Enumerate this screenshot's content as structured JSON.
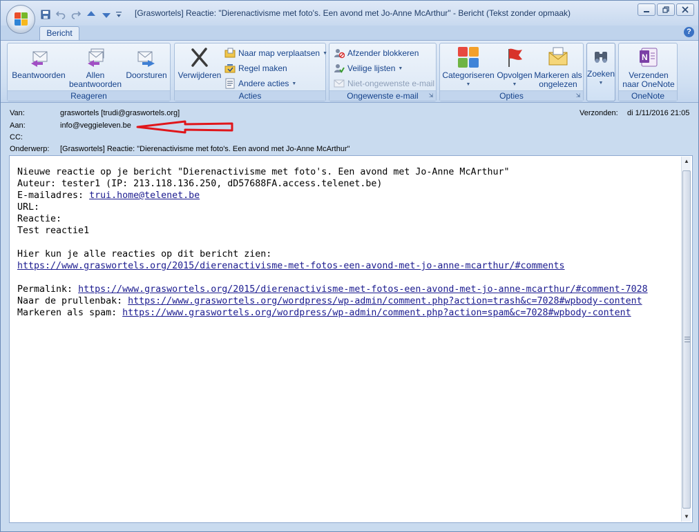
{
  "window": {
    "title": "[Graswortels] Reactie: \"Dierenactivisme met foto's. Een avond met Jo-Anne McArthur\" - Bericht (Tekst zonder opmaak)"
  },
  "quick_access": {
    "icons": [
      "save-icon",
      "undo-icon",
      "redo-icon",
      "up-arrow-icon",
      "down-arrow-icon",
      "customize-icon"
    ]
  },
  "ribbon": {
    "active_tab": "Bericht",
    "groups": {
      "reageren": {
        "label": "Reageren",
        "beantwoorden": "Beantwoorden",
        "allen_line1": "Allen",
        "allen_line2": "beantwoorden",
        "doorsturen": "Doorsturen"
      },
      "acties": {
        "label": "Acties",
        "verwijderen": "Verwijderen",
        "naar_map": "Naar map verplaatsen",
        "regel_maken": "Regel maken",
        "andere_acties": "Andere acties"
      },
      "ongewenste": {
        "label": "Ongewenste e-mail",
        "afzender_blokkeren": "Afzender blokkeren",
        "veilige_lijsten": "Veilige lijsten",
        "niet_ongewenste": "Niet-ongewenste e-mail"
      },
      "opties": {
        "label": "Opties",
        "categoriseren": "Categoriseren",
        "opvolgen": "Opvolgen",
        "markeren_line1": "Markeren als",
        "markeren_line2": "ongelezen"
      },
      "zoeken": {
        "label": "Zoeken"
      },
      "onenote": {
        "label": "OneNote",
        "verzenden_line1": "Verzenden",
        "verzenden_line2": "naar OneNote"
      }
    }
  },
  "header": {
    "van_label": "Van:",
    "van_value": "graswortels [trudi@graswortels.org]",
    "aan_label": "Aan:",
    "aan_value": "info@veggieleven.be",
    "cc_label": "CC:",
    "onderwerp_label": "Onderwerp:",
    "onderwerp_value": "[Graswortels] Reactie: \"Dierenactivisme met foto's. Een avond met Jo-Anne McArthur\"",
    "verzonden_label": "Verzonden:",
    "verzonden_value": "di 1/11/2016 21:05"
  },
  "message": {
    "line1": "Nieuwe reactie op je bericht \"Dierenactivisme met foto's. Een avond met Jo-Anne McArthur\"",
    "line2": "Auteur: tester1 (IP: 213.118.136.250, dD57688FA.access.telenet.be)",
    "email_label": "E-mailadres: ",
    "email_link": "trui.home@telenet.be",
    "url_label": "URL:",
    "reactie_label": "Reactie:",
    "reactie_text": "Test reactie1",
    "all_reactions_text": "Hier kun je alle reacties op dit bericht zien:",
    "all_reactions_link": "https://www.graswortels.org/2015/dierenactivisme-met-fotos-een-avond-met-jo-anne-mcarthur/#comments",
    "permalink_label": "Permalink: ",
    "permalink_link": "https://www.graswortels.org/2015/dierenactivisme-met-fotos-een-avond-met-jo-anne-mcarthur/#comment-7028",
    "trash_label": "Naar de prullenbak: ",
    "trash_link": "https://www.graswortels.org/wordpress/wp-admin/comment.php?action=trash&c=7028#wpbody-content",
    "spam_label": "Markeren als spam: ",
    "spam_link": "https://www.graswortels.org/wordpress/wp-admin/comment.php?action=spam&c=7028#wpbody-content"
  },
  "colors": {
    "ribbon_text": "#15428b",
    "link": "#1b1b8f",
    "annotation_arrow": "#e0161b",
    "frame": "#c9dbef"
  }
}
